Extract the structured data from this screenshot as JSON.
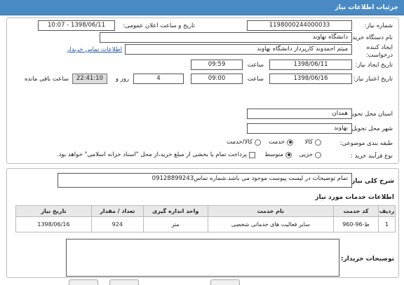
{
  "header": {
    "title": "جزئیات اطلاعات نیاز"
  },
  "form": {
    "need_number": {
      "label": "شماره نیاز:",
      "value": "1198000244000033"
    },
    "announce_datetime": {
      "label": "تاریخ و ساعت اعلان عمومی:",
      "value": "1398/06/11 - 10:07"
    },
    "buyer_org": {
      "label": "نام دستگاه خریدار:",
      "value": "دانشگاه نهاوند"
    },
    "requester": {
      "label": "ایجاد کننده درخواست:",
      "value": "میثم احمدوند کارپرداز دانشگاه نهاوند",
      "contact_link": "اطلاعات تماس خریدار"
    },
    "creation_date": {
      "label": "تاریخ ایجاد نیاز:",
      "date": "1398/06/11",
      "time_label": "ساعت",
      "time": "09:59"
    },
    "validity_deadline": {
      "label": "تاریخ اعتبار نیاز:",
      "date": "1398/06/16",
      "time_label": "ساعت",
      "time": "09:00",
      "days": "4",
      "days_label": "روز و",
      "remaining": "22:41:10",
      "remaining_label": "ساعت باقی مانده"
    },
    "delivery_province": {
      "label": "استان محل تحویل:",
      "value": "همدان"
    },
    "delivery_city": {
      "label": "شهر محل تحویل:",
      "value": "نهاوند"
    },
    "category": {
      "label": "طبقه بندی موضوعی:",
      "options": [
        "کالا",
        "خدمت",
        "کالا/خدمت"
      ],
      "selected": "خدمت"
    },
    "purchase_type": {
      "label": "نوع فرآیند خرید :",
      "options": [
        "جزیی",
        "متوسط"
      ],
      "selected": "متوسط",
      "note": "پرداخت تمام یا بخشی از مبلغ خرید،از محل \"اسناد خزانه اسلامی\" خواهد بود."
    }
  },
  "description": {
    "label": "شرح کلی نیاز:",
    "value": "تمام توضیحات در لیست پیوست موجود می باشد.شماره تماس09128899243"
  },
  "services": {
    "title": "اطلاعات خدمات مورد نیاز",
    "columns": [
      "ردیف",
      "کد خدمت",
      "نام خدمت",
      "واحد اندازه گیری",
      "تعداد / مقدار",
      "تاریخ نیاز"
    ],
    "rows": [
      [
        "1",
        "ط-96-960",
        "سایر فعالیت های خدماتی شخصی",
        "متر",
        "924",
        "1398/06/16"
      ]
    ]
  },
  "buyer_notes": {
    "label": "توضیحات خریدار:",
    "value": ""
  },
  "colors": {
    "header": "#4a8ac4",
    "field_gray": "#dddddd"
  }
}
